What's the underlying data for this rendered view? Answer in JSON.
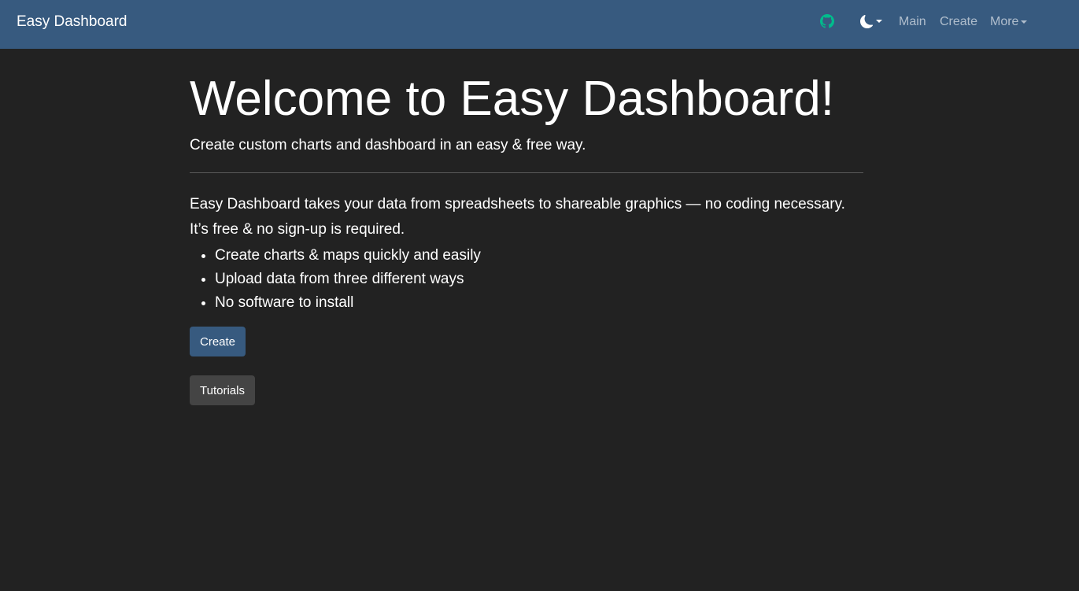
{
  "navbar": {
    "brand": "Easy Dashboard",
    "github_icon": "github-icon",
    "github_color": "#00bc8c",
    "theme_icon": "moon-icon",
    "links": {
      "main": "Main",
      "create": "Create",
      "more": "More"
    },
    "background": "#375a7f"
  },
  "hero": {
    "title": "Welcome to Easy Dashboard!",
    "subtitle": "Create custom charts and dashboard in an easy & free way."
  },
  "intro": {
    "line1": "Easy Dashboard takes your data from spreadsheets to shareable graphics — no coding necessary.",
    "line2": "It’s free & no sign-up is required."
  },
  "features": [
    "Create charts & maps quickly and easily",
    "Upload data from three different ways",
    "No software to install"
  ],
  "buttons": {
    "create": "Create",
    "tutorials": "Tutorials"
  },
  "colors": {
    "page_background": "#222222",
    "primary": "#375a7f",
    "secondary": "#444444",
    "accent": "#00bc8c"
  }
}
